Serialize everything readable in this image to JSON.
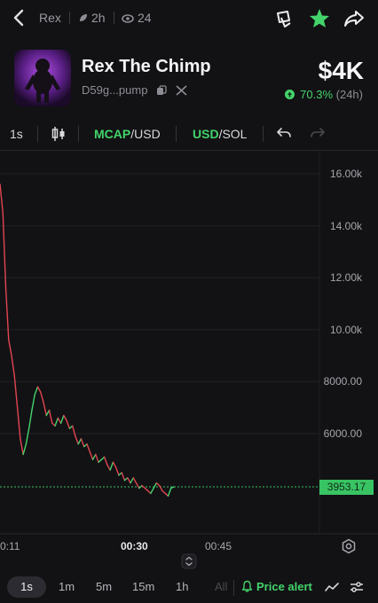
{
  "topbar": {
    "ticker": "Rex",
    "age": "2h",
    "views": "24",
    "icons": [
      "back-icon",
      "leaf-icon",
      "eye-icon",
      "copy-window-icon",
      "star-icon",
      "share-icon"
    ]
  },
  "token": {
    "name": "Rex The Chimp",
    "address": "D59g...pump",
    "price": "$4K",
    "change_pct": "70.3%",
    "change_period": "(24h)"
  },
  "toolbar": {
    "interval": "1s",
    "mcap_label": "MCAP",
    "mcap_unit": "/USD",
    "usd_label": "USD",
    "usd_unit": "/SOL"
  },
  "chart_data": {
    "type": "line",
    "y_ticks": [
      "16.00k",
      "14.00k",
      "12.00k",
      "10.00k",
      "8000.00",
      "6000.00"
    ],
    "x_ticks": [
      "0:11",
      "00:30",
      "00:45"
    ],
    "current_value": "3953.17",
    "ylim": [
      3000,
      17000
    ],
    "grid": true,
    "series": [
      {
        "x": [
          0,
          1,
          2,
          3,
          4,
          5,
          6,
          7,
          8,
          9,
          10,
          11,
          12,
          13,
          14,
          15,
          16,
          17,
          18,
          19,
          20,
          21,
          22,
          23,
          24,
          25,
          26,
          27,
          28,
          29,
          30,
          31,
          32,
          33,
          34,
          35,
          36,
          37,
          38,
          39,
          40,
          41,
          42,
          43,
          44,
          45,
          46,
          47,
          48,
          49,
          50,
          51,
          52,
          53,
          54,
          55,
          56,
          57,
          58,
          59,
          60
        ],
        "y": [
          15600,
          14500,
          11600,
          9600,
          9000,
          8200,
          7000,
          5800,
          5200,
          5600,
          6200,
          6900,
          7500,
          7800,
          7600,
          7200,
          6700,
          6900,
          6400,
          6300,
          6600,
          6400,
          6700,
          6500,
          6200,
          6300,
          5900,
          5600,
          5800,
          5500,
          5600,
          5300,
          5000,
          5200,
          4900,
          5000,
          5100,
          4800,
          4600,
          4900,
          4700,
          4400,
          4500,
          4200,
          4300,
          4100,
          4300,
          4100,
          3900,
          4000,
          3900,
          3800,
          3700,
          3900,
          4100,
          4000,
          3800,
          3700,
          3600,
          3900,
          3950
        ]
      }
    ]
  },
  "bottombar": {
    "timeframes": [
      "1s",
      "1m",
      "5m",
      "15m",
      "1h",
      "All"
    ],
    "alert": "Price alert"
  },
  "colors": {
    "up": "#43d36a",
    "down": "#e2454f",
    "bg": "#121215"
  }
}
